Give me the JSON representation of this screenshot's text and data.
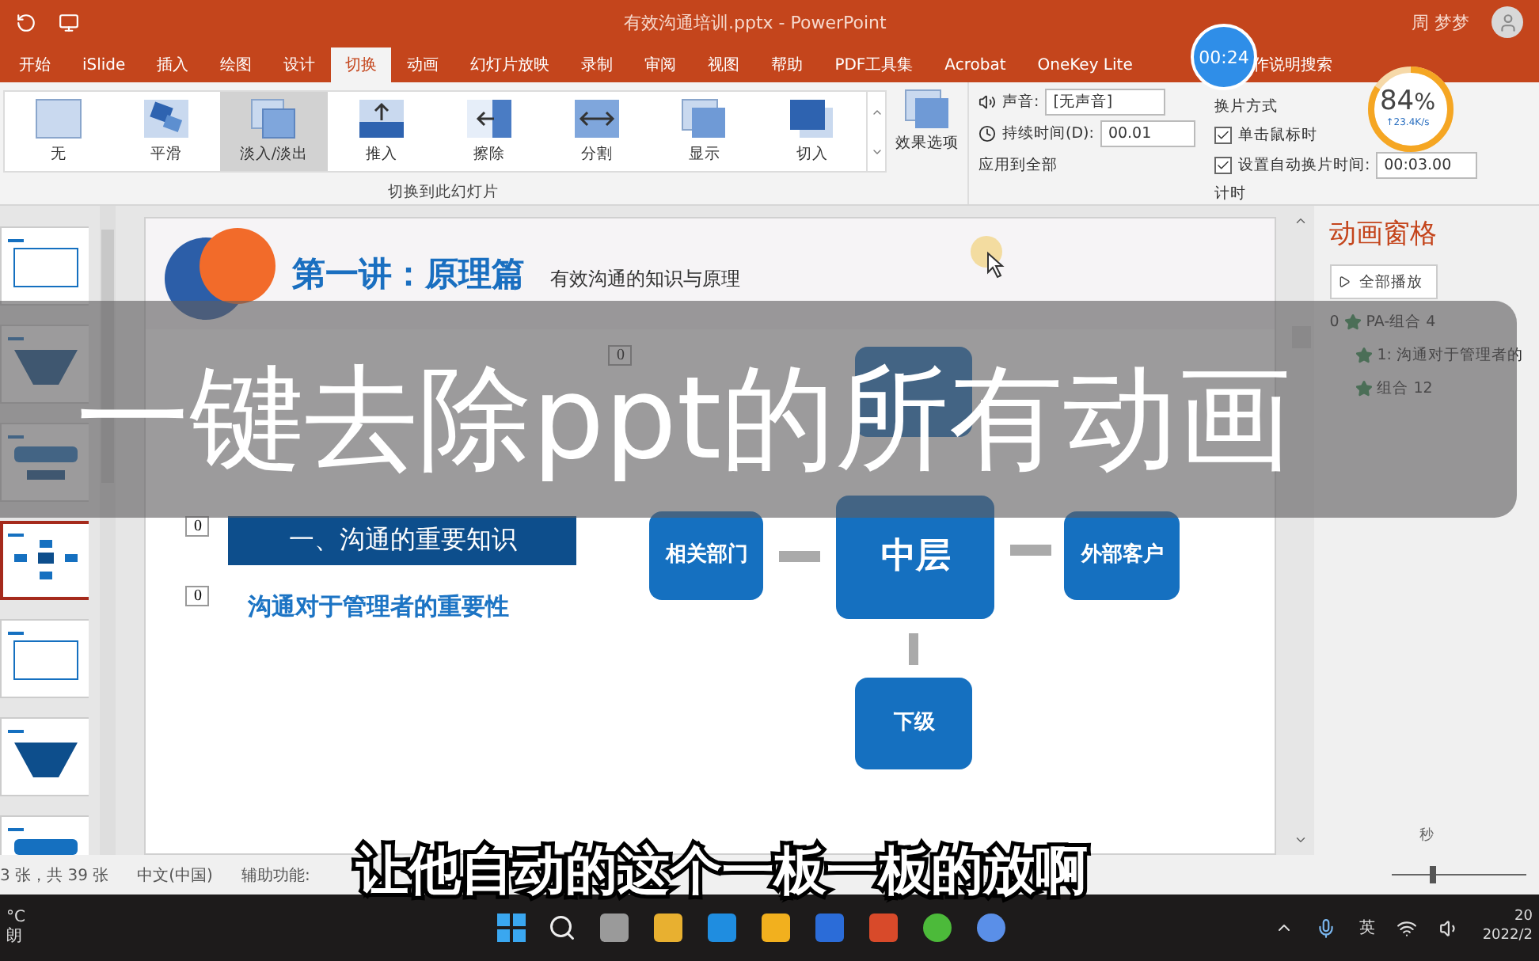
{
  "title_bar": {
    "title": "有效沟通培训.pptx - PowerPoint",
    "user": "周 梦梦"
  },
  "tabs": [
    {
      "label": "开始",
      "selected": false
    },
    {
      "label": "iSlide",
      "selected": false
    },
    {
      "label": "插入",
      "selected": false
    },
    {
      "label": "绘图",
      "selected": false
    },
    {
      "label": "设计",
      "selected": false
    },
    {
      "label": "切换",
      "selected": true
    },
    {
      "label": "动画",
      "selected": false
    },
    {
      "label": "幻灯片放映",
      "selected": false
    },
    {
      "label": "录制",
      "selected": false
    },
    {
      "label": "审阅",
      "selected": false
    },
    {
      "label": "视图",
      "selected": false
    },
    {
      "label": "帮助",
      "selected": false
    },
    {
      "label": "PDF工具集",
      "selected": false
    },
    {
      "label": "Acrobat",
      "selected": false
    },
    {
      "label": "OneKey Lite",
      "selected": false
    }
  ],
  "search": {
    "placeholder": "作说明搜索"
  },
  "transitions": [
    {
      "label": "无",
      "selected": false
    },
    {
      "label": "平滑",
      "selected": false
    },
    {
      "label": "淡入/淡出",
      "selected": true
    },
    {
      "label": "推入",
      "selected": false
    },
    {
      "label": "擦除",
      "selected": false
    },
    {
      "label": "分割",
      "selected": false
    },
    {
      "label": "显示",
      "selected": false
    },
    {
      "label": "切入",
      "selected": false
    }
  ],
  "effect_options": "效果选项",
  "group_label": "切换到此幻灯片",
  "sound": {
    "label": "声音:",
    "value": "[无声音]"
  },
  "duration": {
    "label": "持续时间(D):",
    "value": "00.01"
  },
  "apply_all": "应用到全部",
  "advance": {
    "title": "换片方式",
    "on_click": {
      "label": "单击鼠标时",
      "checked": true
    },
    "after_time": {
      "label": "设置自动换片时间:",
      "checked": true,
      "value": "00:03.00"
    }
  },
  "timing_label": "计时",
  "recording_timer": "00:24",
  "network_meter": {
    "percent": "84",
    "unit": "%",
    "speed": "↑23.4K/s",
    "level": 0.84
  },
  "thumbnails": [
    {
      "selected": false
    },
    {
      "selected": false
    },
    {
      "selected": false
    },
    {
      "selected": true
    },
    {
      "selected": false
    },
    {
      "selected": false
    },
    {
      "selected": false
    }
  ],
  "slide": {
    "title": "第一讲：原理篇",
    "subtitle": "有效沟通的知识与原理",
    "tags": [
      "0",
      "0",
      "0"
    ],
    "section": "一、沟通的重要知识",
    "heading": "沟通对于管理者的重要性",
    "nodes": [
      {
        "label": "相关部门"
      },
      {
        "label": "中层"
      },
      {
        "label": "外部客户"
      },
      {
        "label": "下级"
      }
    ]
  },
  "animation_pane": {
    "title": "动画窗格",
    "play_all": "全部播放",
    "items": [
      {
        "number": "0",
        "label": "PA-组合 4",
        "children": [
          {
            "label": "1: 沟通对于管理者的"
          },
          {
            "label": "组合 12"
          }
        ]
      }
    ],
    "unit": "秒"
  },
  "status_bar": {
    "slide_count": "3 张，共 39 张",
    "language": "中文(中国)",
    "accessibility": "辅助功能:",
    "zoom": {
      "level": 0.3
    }
  },
  "taskbar": {
    "weather": [
      "°C",
      "朗"
    ],
    "ime": "英",
    "time": "20",
    "date": "2022/2"
  },
  "overlays": {
    "headline": "一键去除ppt的所有动画",
    "caption": "让他自动的这个一板一板的放啊"
  }
}
